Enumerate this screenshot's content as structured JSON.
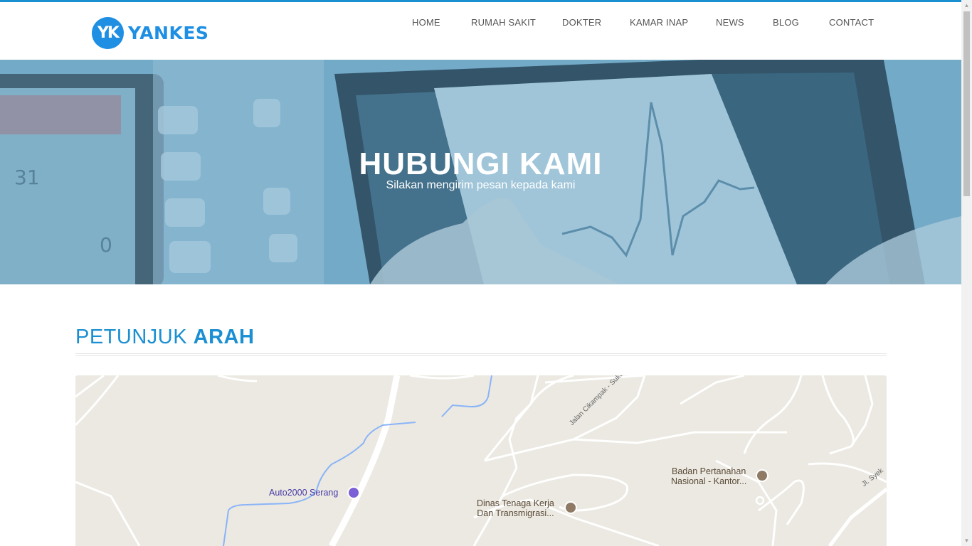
{
  "brand": {
    "logo_initials": "YK",
    "logo_text": "YANKES",
    "accent_color": "#1e8fe3"
  },
  "nav": {
    "items": [
      {
        "label": "HOME"
      },
      {
        "label": "RUMAH SAKIT"
      },
      {
        "label": "DOKTER"
      },
      {
        "label": "KAMAR INAP"
      },
      {
        "label": "NEWS"
      },
      {
        "label": "BLOG"
      },
      {
        "label": "CONTACT"
      }
    ]
  },
  "hero": {
    "title": "HUBUNGI KAMI",
    "subtitle": "Silakan mengirim pesan kepada kami"
  },
  "directions": {
    "title_light": "PETUNJUK",
    "title_bold": "ARAH"
  },
  "map": {
    "road_labels": {
      "cikampak": "Jalan Cikampak - Sukajaya",
      "syekh": "Jl. Syek"
    },
    "places": {
      "auto2000": "Auto2000 Serang",
      "disnaker_line1": "Dinas Tenaga Kerja",
      "disnaker_line2": "Dan Transmigrasi...",
      "bpn_line1": "Badan Pertanahan",
      "bpn_line2": "Nasional - Kantor..."
    },
    "icons": {
      "shop": "shopping-bag-icon",
      "government": "government-building-icon"
    }
  }
}
